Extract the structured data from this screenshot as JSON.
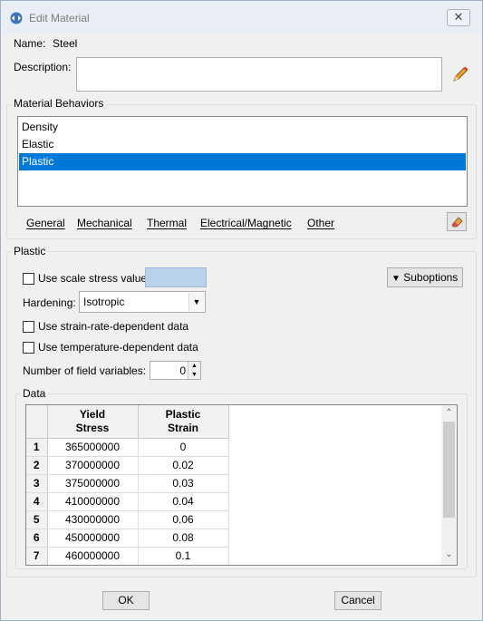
{
  "window": {
    "title": "Edit Material"
  },
  "name": {
    "label": "Name:",
    "value": "Steel"
  },
  "description": {
    "label": "Description:",
    "value": ""
  },
  "behaviors": {
    "title": "Material Behaviors",
    "items": [
      {
        "label": "Density",
        "selected": false
      },
      {
        "label": "Elastic",
        "selected": false
      },
      {
        "label": "Plastic",
        "selected": true
      }
    ],
    "menu": [
      "General",
      "Mechanical",
      "Thermal",
      "Electrical/Magnetic",
      "Other"
    ]
  },
  "plastic": {
    "title": "Plastic",
    "scale_stress_label": "Use scale stress value:",
    "scale_stress_value": "",
    "suboptions_label": "Suboptions",
    "hardening_label": "Hardening:",
    "hardening_value": "Isotropic",
    "strain_rate_label": "Use strain-rate-dependent data",
    "temperature_label": "Use temperature-dependent data",
    "field_vars_label": "Number of field variables:",
    "field_vars_value": "0"
  },
  "data": {
    "title": "Data",
    "columns": [
      {
        "line1": "Yield",
        "line2": "Stress"
      },
      {
        "line1": "Plastic",
        "line2": "Strain"
      }
    ],
    "rows": [
      {
        "n": "1",
        "stress": "365000000",
        "strain": "0"
      },
      {
        "n": "2",
        "stress": "370000000",
        "strain": "0.02"
      },
      {
        "n": "3",
        "stress": "375000000",
        "strain": "0.03"
      },
      {
        "n": "4",
        "stress": "410000000",
        "strain": "0.04"
      },
      {
        "n": "5",
        "stress": "430000000",
        "strain": "0.06"
      },
      {
        "n": "6",
        "stress": "450000000",
        "strain": "0.08"
      },
      {
        "n": "7",
        "stress": "460000000",
        "strain": "0.1"
      }
    ]
  },
  "buttons": {
    "ok": "OK",
    "cancel": "Cancel"
  },
  "colors": {
    "selection": "#0078d7",
    "scale_field": "#b9d1ea"
  },
  "icons": [
    "abaqus-icon",
    "close-icon",
    "pencil-icon",
    "eraser-icon",
    "dropdown-arrow-icon",
    "spin-up-icon",
    "spin-down-icon"
  ]
}
